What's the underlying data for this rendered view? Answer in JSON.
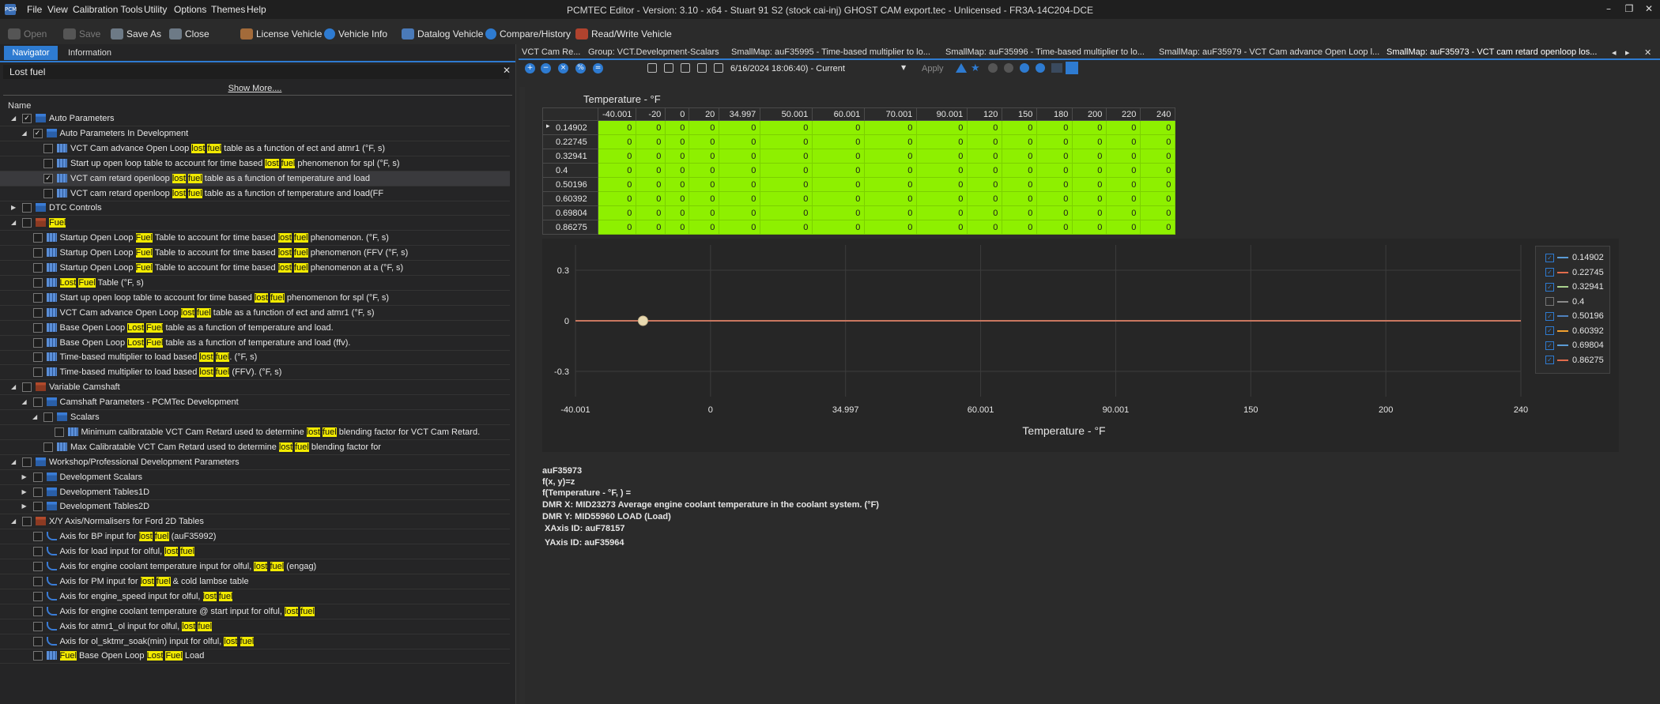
{
  "window": {
    "title": "PCMTEC Editor - Version: 3.10 - x64 - Stuart 91 S2 (stock cai-inj) GHOST CAM export.tec - Unlicensed - FR3A-14C204-DCE",
    "app_icon_text": "PCM",
    "menus": [
      "File",
      "View",
      "Calibration Tools",
      "Utility",
      "Options",
      "Themes",
      "Help"
    ]
  },
  "toolbar": {
    "open": "Open",
    "save": "Save",
    "save_as": "Save As",
    "close": "Close",
    "license_vehicle": "License Vehicle",
    "vehicle_info": "Vehicle Info",
    "datalog_vehicle": "Datalog Vehicle",
    "compare_history": "Compare/History",
    "read_write_vehicle": "Read/Write Vehicle"
  },
  "left_panel": {
    "tab_navigator": "Navigator",
    "tab_information": "Information",
    "search_value": "Lost fuel",
    "search_close": "✕",
    "show_more": "Show More....",
    "column_name": "Name"
  },
  "tree": [
    {
      "level": 0,
      "expand": "open",
      "check": "checked",
      "icon": "folder",
      "parts": [
        [
          "Auto Parameters",
          false
        ]
      ]
    },
    {
      "level": 1,
      "expand": "open",
      "check": "checked",
      "icon": "folder",
      "parts": [
        [
          "Auto Parameters In Development",
          false
        ]
      ]
    },
    {
      "level": 2,
      "check": "empty",
      "icon": "table",
      "parts": [
        [
          "VCT Cam advance Open Loop ",
          false
        ],
        [
          "lost",
          true
        ],
        [
          "  ",
          false
        ],
        [
          "fuel",
          true
        ],
        [
          " table as a function of ect and atmr1 (°F, s)",
          false
        ]
      ]
    },
    {
      "level": 2,
      "check": "empty",
      "icon": "table",
      "parts": [
        [
          "Start up open loop  table to account for time based ",
          false
        ],
        [
          "lost",
          true
        ],
        [
          " ",
          false
        ],
        [
          "fuel",
          true
        ],
        [
          " phenomenon for spl (°F, s)",
          false
        ]
      ]
    },
    {
      "level": 2,
      "check": "checked",
      "icon": "table",
      "selected": true,
      "parts": [
        [
          "VCT cam retard openloop ",
          false
        ],
        [
          "lost",
          true
        ],
        [
          " ",
          false
        ],
        [
          "fuel",
          true
        ],
        [
          " table as a function of temperature and load",
          false
        ]
      ]
    },
    {
      "level": 2,
      "check": "empty",
      "icon": "table",
      "parts": [
        [
          "VCT cam retard openloop ",
          false
        ],
        [
          "lost",
          true
        ],
        [
          " ",
          false
        ],
        [
          "fuel",
          true
        ],
        [
          " table as a function of temperature and load(FF",
          false
        ]
      ]
    },
    {
      "level": 0,
      "expand": "closed",
      "check": "empty",
      "icon": "folder",
      "parts": [
        [
          "DTC Controls",
          false
        ]
      ]
    },
    {
      "level": 0,
      "expand": "open",
      "check": "empty",
      "icon": "red",
      "parts": [
        [
          "Fuel",
          true
        ]
      ]
    },
    {
      "level": 1,
      "check": "empty",
      "icon": "table",
      "parts": [
        [
          "Startup Open Loop ",
          false
        ],
        [
          "Fuel",
          true
        ],
        [
          " Table to account for time based ",
          false
        ],
        [
          "lost",
          true
        ],
        [
          " ",
          false
        ],
        [
          "fuel",
          true
        ],
        [
          " phenomenon. (°F, s)",
          false
        ]
      ]
    },
    {
      "level": 1,
      "check": "empty",
      "icon": "table",
      "parts": [
        [
          "Startup Open Loop ",
          false
        ],
        [
          "Fuel",
          true
        ],
        [
          " Table to account for time based ",
          false
        ],
        [
          "lost",
          true
        ],
        [
          " ",
          false
        ],
        [
          "fuel",
          true
        ],
        [
          " phenomenon (FFV (°F, s)",
          false
        ]
      ]
    },
    {
      "level": 1,
      "check": "empty",
      "icon": "table",
      "parts": [
        [
          "Startup Open Loop ",
          false
        ],
        [
          "Fuel",
          true
        ],
        [
          " Table to account for time based ",
          false
        ],
        [
          "lost",
          true
        ],
        [
          " ",
          false
        ],
        [
          "fuel",
          true
        ],
        [
          " phenomenon at a (°F, s)",
          false
        ]
      ]
    },
    {
      "level": 1,
      "check": "empty",
      "icon": "table",
      "parts": [
        [
          "Lost",
          true
        ],
        [
          " ",
          false
        ],
        [
          "Fuel",
          true
        ],
        [
          " Table (°F, s)",
          false
        ]
      ]
    },
    {
      "level": 1,
      "check": "empty",
      "icon": "table",
      "parts": [
        [
          "Start up open loop  table to account for time based ",
          false
        ],
        [
          "lost",
          true
        ],
        [
          " ",
          false
        ],
        [
          "fuel",
          true
        ],
        [
          " phenomenon for spl (°F, s)",
          false
        ]
      ]
    },
    {
      "level": 1,
      "check": "empty",
      "icon": "table",
      "parts": [
        [
          "VCT Cam advance Open Loop ",
          false
        ],
        [
          "lost",
          true
        ],
        [
          "  ",
          false
        ],
        [
          "fuel",
          true
        ],
        [
          " table as a function of ect and atmr1 (°F, s)",
          false
        ]
      ]
    },
    {
      "level": 1,
      "check": "empty",
      "icon": "table",
      "parts": [
        [
          "Base Open Loop ",
          false
        ],
        [
          "Lost",
          true
        ],
        [
          " ",
          false
        ],
        [
          "Fuel",
          true
        ],
        [
          " table as a function of temperature and load.",
          false
        ]
      ]
    },
    {
      "level": 1,
      "check": "empty",
      "icon": "table",
      "parts": [
        [
          "Base Open Loop ",
          false
        ],
        [
          "Lost",
          true
        ],
        [
          " ",
          false
        ],
        [
          "Fuel",
          true
        ],
        [
          " table as a function of temperature and load (ffv).",
          false
        ]
      ]
    },
    {
      "level": 1,
      "check": "empty",
      "icon": "table",
      "parts": [
        [
          "Time-based multiplier to load based ",
          false
        ],
        [
          "lost",
          true
        ],
        [
          " ",
          false
        ],
        [
          "fuel",
          true
        ],
        [
          ". (°F, s)",
          false
        ]
      ]
    },
    {
      "level": 1,
      "check": "empty",
      "icon": "table",
      "parts": [
        [
          "Time-based multiplier to load based ",
          false
        ],
        [
          "lost",
          true
        ],
        [
          " ",
          false
        ],
        [
          "fuel",
          true
        ],
        [
          " (FFV). (°F, s)",
          false
        ]
      ]
    },
    {
      "level": 0,
      "expand": "open",
      "check": "empty",
      "icon": "red",
      "parts": [
        [
          "Variable Camshaft",
          false
        ]
      ]
    },
    {
      "level": 1,
      "expand": "open",
      "check": "empty",
      "icon": "folder",
      "parts": [
        [
          "Camshaft Parameters - PCMTec Development",
          false
        ]
      ]
    },
    {
      "level": 2,
      "expand": "open",
      "check": "empty",
      "icon": "folder",
      "parts": [
        [
          "Scalars",
          false
        ]
      ]
    },
    {
      "level": 3,
      "check": "empty",
      "icon": "table",
      "parts": [
        [
          "Minimum calibratable VCT Cam Retard used to determine ",
          false
        ],
        [
          "lost",
          true
        ],
        [
          " ",
          false
        ],
        [
          "fuel",
          true
        ],
        [
          " blending factor for VCT Cam Retard.",
          false
        ]
      ]
    },
    {
      "level": 2,
      "check": "empty",
      "icon": "table",
      "parts": [
        [
          "Max Calibratable VCT Cam Retard used to determine ",
          false
        ],
        [
          "lost",
          true
        ],
        [
          " ",
          false
        ],
        [
          "fuel",
          true
        ],
        [
          " blending factor for",
          false
        ]
      ]
    },
    {
      "level": 0,
      "expand": "open",
      "check": "empty",
      "icon": "folder",
      "parts": [
        [
          "Workshop/Professional Development Parameters",
          false
        ]
      ]
    },
    {
      "level": 1,
      "expand": "closed",
      "check": "empty",
      "icon": "folder",
      "parts": [
        [
          "Development Scalars",
          false
        ]
      ]
    },
    {
      "level": 1,
      "expand": "closed",
      "check": "empty",
      "icon": "folder",
      "parts": [
        [
          "Development Tables1D",
          false
        ]
      ]
    },
    {
      "level": 1,
      "expand": "closed",
      "check": "empty",
      "icon": "folder",
      "parts": [
        [
          "Development Tables2D",
          false
        ]
      ]
    },
    {
      "level": 0,
      "expand": "open",
      "check": "empty",
      "icon": "red",
      "parts": [
        [
          "X/Y Axis/Normalisers for Ford 2D Tables",
          false
        ]
      ]
    },
    {
      "level": 1,
      "check": "empty",
      "icon": "curve",
      "parts": [
        [
          "Axis for BP  input for ",
          false
        ],
        [
          "lost",
          true
        ],
        [
          " ",
          false
        ],
        [
          "fuel",
          true
        ],
        [
          " (auF35992)",
          false
        ]
      ]
    },
    {
      "level": 1,
      "check": "empty",
      "icon": "curve",
      "parts": [
        [
          "Axis for load input for olful, ",
          false
        ],
        [
          "lost",
          true
        ],
        [
          " ",
          false
        ],
        [
          "fuel",
          true
        ]
      ]
    },
    {
      "level": 1,
      "check": "empty",
      "icon": "curve",
      "parts": [
        [
          "Axis for engine coolant temperature input for olful, ",
          false
        ],
        [
          "lost",
          true
        ],
        [
          " ",
          false
        ],
        [
          "fuel",
          true
        ],
        [
          " (engag)",
          false
        ]
      ]
    },
    {
      "level": 1,
      "check": "empty",
      "icon": "curve",
      "parts": [
        [
          "Axis for PM input for ",
          false
        ],
        [
          "lost",
          true
        ],
        [
          " ",
          false
        ],
        [
          "fuel",
          true
        ],
        [
          " & cold lambse table",
          false
        ]
      ]
    },
    {
      "level": 1,
      "check": "empty",
      "icon": "curve",
      "parts": [
        [
          "Axis for engine_speed  input for olful, ",
          false
        ],
        [
          "lost",
          true
        ],
        [
          " ",
          false
        ],
        [
          "fuel",
          true
        ]
      ]
    },
    {
      "level": 1,
      "check": "empty",
      "icon": "curve",
      "parts": [
        [
          "Axis for engine coolant temperature @ start input for olful, ",
          false
        ],
        [
          "lost",
          true
        ],
        [
          " ",
          false
        ],
        [
          "fuel",
          true
        ]
      ]
    },
    {
      "level": 1,
      "check": "empty",
      "icon": "curve",
      "parts": [
        [
          "Axis for atmr1_ol input for olful, ",
          false
        ],
        [
          "lost",
          true
        ],
        [
          " ",
          false
        ],
        [
          "fuel",
          true
        ]
      ]
    },
    {
      "level": 1,
      "check": "empty",
      "icon": "curve",
      "parts": [
        [
          "Axis for ol_sktmr_soak(min) input for olful, ",
          false
        ],
        [
          "lost",
          true
        ],
        [
          " ",
          false
        ],
        [
          "fuel",
          true
        ]
      ]
    },
    {
      "level": 1,
      "check": "empty",
      "icon": "table",
      "parts": [
        [
          "Fuel",
          true
        ],
        [
          " Base Open Loop ",
          false
        ],
        [
          "Lost",
          true
        ],
        [
          " ",
          false
        ],
        [
          "Fuel",
          true
        ],
        [
          " Load",
          false
        ]
      ]
    }
  ],
  "doc_tabs": [
    {
      "label": "VCT Cam Re...",
      "active": false
    },
    {
      "label": "Group: VCT.Development-Scalars",
      "active": false
    },
    {
      "label": "SmallMap: auF35995 - Time-based multiplier to lo...",
      "active": false
    },
    {
      "label": "SmallMap: auF35996 - Time-based multiplier to lo...",
      "active": false
    },
    {
      "label": "SmallMap: auF35979 - VCT Cam advance Open Loop l...",
      "active": false
    },
    {
      "label": "SmallMap: auF35973 - VCT cam retard openloop los...",
      "active": true
    }
  ],
  "doc_tab_controls": {
    "prev": "◂",
    "next": "▸",
    "close": "✕"
  },
  "table_toolbar": {
    "version": "6/16/2024 18:06:40) - Current",
    "apply": "Apply"
  },
  "table": {
    "axis_title": "Temperature - °F",
    "columns": [
      "-40.001",
      "-20",
      "0",
      "20",
      "34.997",
      "50.001",
      "60.001",
      "70.001",
      "90.001",
      "120",
      "150",
      "180",
      "200",
      "220",
      "240"
    ],
    "rows": [
      "0.14902",
      "0.22745",
      "0.32941",
      "0.4",
      "0.50196",
      "0.60392",
      "0.69804",
      "0.86275"
    ],
    "value": "0"
  },
  "chart_data": {
    "type": "line",
    "xlabel": "Temperature - °F",
    "ylabel": "",
    "x_ticks": [
      "-40.001",
      "0",
      "34.997",
      "60.001",
      "90.001",
      "150",
      "200",
      "240"
    ],
    "y_ticks": [
      "0.3",
      "0",
      "-0.3"
    ],
    "ylim": [
      -0.45,
      0.45
    ],
    "grid": true,
    "legend_position": "right",
    "categories": [
      "-40.001",
      "-20",
      "0",
      "20",
      "34.997",
      "50.001",
      "60.001",
      "70.001",
      "90.001",
      "120",
      "150",
      "180",
      "200",
      "220",
      "240"
    ],
    "series": [
      {
        "name": "0.14902",
        "color": "#5b9bd5",
        "values": [
          0,
          0,
          0,
          0,
          0,
          0,
          0,
          0,
          0,
          0,
          0,
          0,
          0,
          0,
          0
        ]
      },
      {
        "name": "0.22745",
        "color": "#e06c4c",
        "values": [
          0,
          0,
          0,
          0,
          0,
          0,
          0,
          0,
          0,
          0,
          0,
          0,
          0,
          0,
          0
        ]
      },
      {
        "name": "0.32941",
        "color": "#a9d18e",
        "values": [
          0,
          0,
          0,
          0,
          0,
          0,
          0,
          0,
          0,
          0,
          0,
          0,
          0,
          0,
          0
        ]
      },
      {
        "name": "0.4",
        "color": "#8a8a8a",
        "values": [
          0,
          0,
          0,
          0,
          0,
          0,
          0,
          0,
          0,
          0,
          0,
          0,
          0,
          0,
          0
        ]
      },
      {
        "name": "0.50196",
        "color": "#4f81bd",
        "values": [
          0,
          0,
          0,
          0,
          0,
          0,
          0,
          0,
          0,
          0,
          0,
          0,
          0,
          0,
          0
        ]
      },
      {
        "name": "0.60392",
        "color": "#f0a030",
        "values": [
          0,
          0,
          0,
          0,
          0,
          0,
          0,
          0,
          0,
          0,
          0,
          0,
          0,
          0,
          0
        ]
      },
      {
        "name": "0.69804",
        "color": "#5b9bd5",
        "values": [
          0,
          0,
          0,
          0,
          0,
          0,
          0,
          0,
          0,
          0,
          0,
          0,
          0,
          0,
          0
        ]
      },
      {
        "name": "0.86275",
        "color": "#e06c4c",
        "values": [
          0,
          0,
          0,
          0,
          0,
          0,
          0,
          0,
          0,
          0,
          0,
          0,
          0,
          0,
          0
        ]
      }
    ],
    "highlight_point": {
      "x": "-20",
      "y": 0
    }
  },
  "info": {
    "line1": "auF35973",
    "line2": "f(x, y)=z",
    "line3": "f(Temperature - °F, ) =",
    "line4": "DMR X: MID23273 Average engine coolant temperature in the coolant system. (°F)",
    "line5": "DMR Y: MID55960 LOAD (Load)",
    "line6": "XAxis ID: auF78157",
    "line7": "YAxis ID: auF35964"
  },
  "colors": {
    "accent": "#2e7bd1",
    "cell_fill": "#8ef000",
    "highlight": "#f2ea00"
  }
}
